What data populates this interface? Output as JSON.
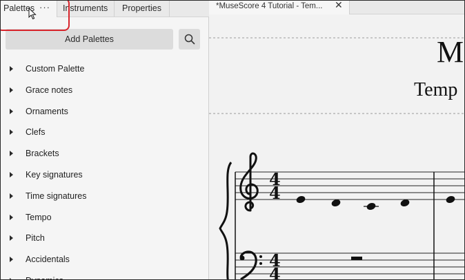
{
  "panel_tabs": {
    "palettes": "Palettes",
    "palettes_menu": "···",
    "instruments": "Instruments",
    "properties": "Properties"
  },
  "palettes_panel": {
    "add_button": "Add Palettes",
    "items": [
      {
        "label": "Custom Palette"
      },
      {
        "label": "Grace notes"
      },
      {
        "label": "Ornaments"
      },
      {
        "label": "Clefs"
      },
      {
        "label": "Brackets"
      },
      {
        "label": "Key signatures"
      },
      {
        "label": "Time signatures"
      },
      {
        "label": "Tempo"
      },
      {
        "label": "Pitch"
      },
      {
        "label": "Accidentals"
      },
      {
        "label": "Dynamics"
      }
    ]
  },
  "document_tab": {
    "title": "*MuseScore 4 Tutorial - Tem...",
    "close": "✕"
  },
  "score": {
    "title_fragment": "M",
    "subtitle_fragment": "Temp",
    "time_signature_top": "4",
    "time_signature_bottom": "4"
  },
  "colors": {
    "highlight": "#d8232a",
    "panel_bg": "#f5f5f5",
    "score_bg": "#f2f2f2"
  }
}
